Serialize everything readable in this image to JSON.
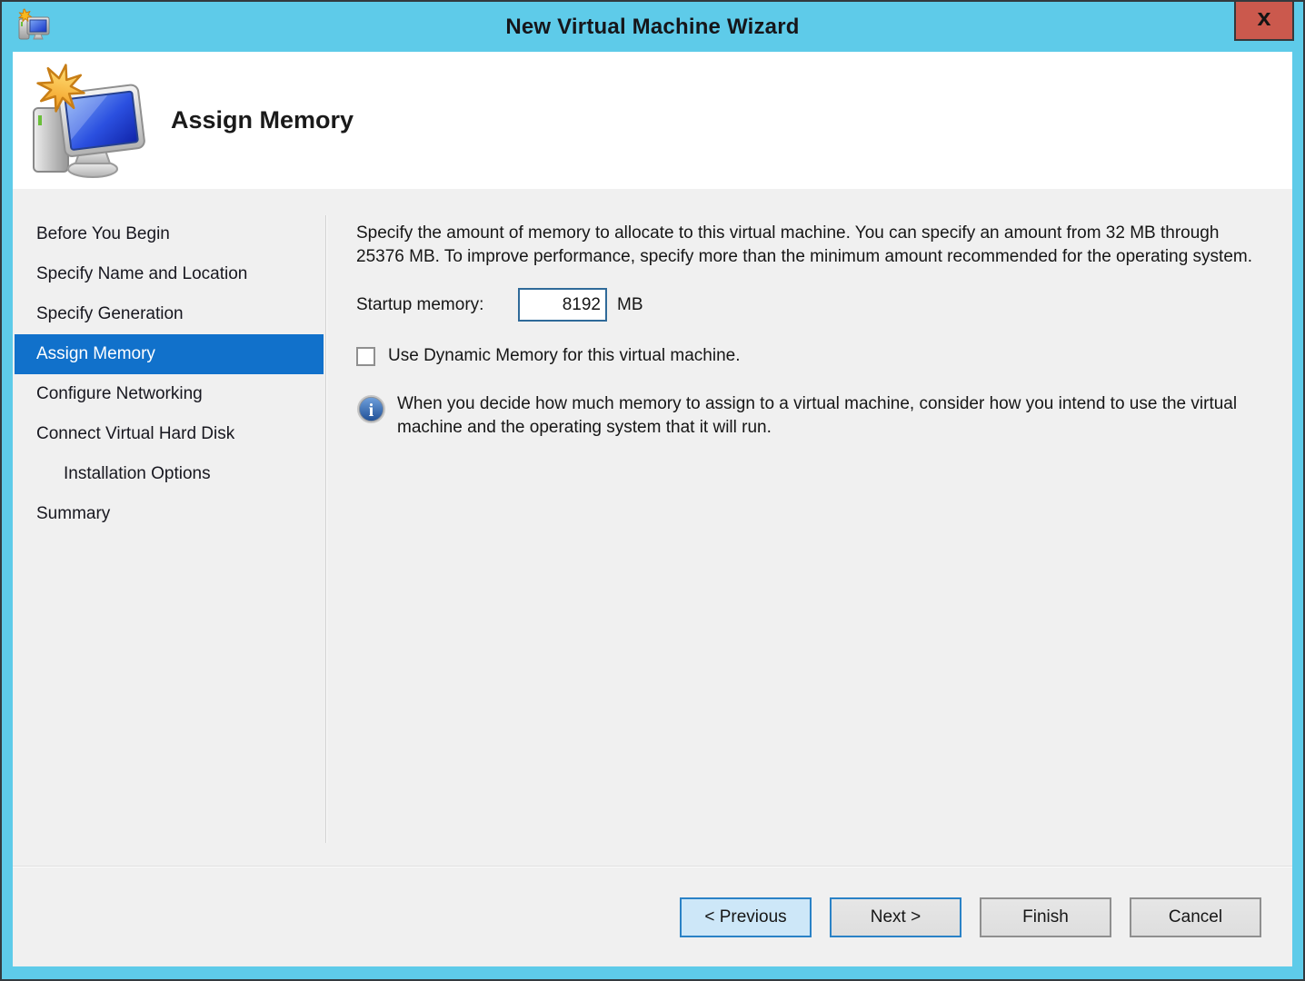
{
  "window": {
    "title": "New Virtual Machine Wizard",
    "close_glyph": "x"
  },
  "header": {
    "title": "Assign Memory"
  },
  "sidebar": {
    "items": [
      {
        "label": "Before You Begin",
        "selected": false,
        "indent": false
      },
      {
        "label": "Specify Name and Location",
        "selected": false,
        "indent": false
      },
      {
        "label": "Specify Generation",
        "selected": false,
        "indent": false
      },
      {
        "label": "Assign Memory",
        "selected": true,
        "indent": false
      },
      {
        "label": "Configure Networking",
        "selected": false,
        "indent": false
      },
      {
        "label": "Connect Virtual Hard Disk",
        "selected": false,
        "indent": false
      },
      {
        "label": "Installation Options",
        "selected": false,
        "indent": true
      },
      {
        "label": "Summary",
        "selected": false,
        "indent": false
      }
    ]
  },
  "main": {
    "description": "Specify the amount of memory to allocate to this virtual machine. You can specify an amount from 32 MB through 25376 MB. To improve performance, specify more than the minimum amount recommended for the operating system.",
    "startup_memory": {
      "label": "Startup memory:",
      "value": "8192",
      "unit": "MB"
    },
    "dynamic_memory": {
      "label": "Use Dynamic Memory for this virtual machine.",
      "checked": false
    },
    "info_note": "When you decide how much memory to assign to a virtual machine, consider how you intend to use the virtual machine and the operating system that it will run."
  },
  "footer": {
    "buttons": [
      {
        "label": "< Previous",
        "style": "hover"
      },
      {
        "label": "Next >",
        "style": "default"
      },
      {
        "label": "Finish",
        "style": "normal"
      },
      {
        "label": "Cancel",
        "style": "normal"
      }
    ]
  },
  "icons": {
    "info_glyph": "i"
  },
  "colors": {
    "titlebar_frame": "#5ecbe9",
    "close_button": "#cb594d",
    "selection_blue": "#1171cb",
    "previous_button_bg": "#cde7f8",
    "focus_border_blue": "#2a82c6",
    "body_background": "#f0f0f0"
  }
}
